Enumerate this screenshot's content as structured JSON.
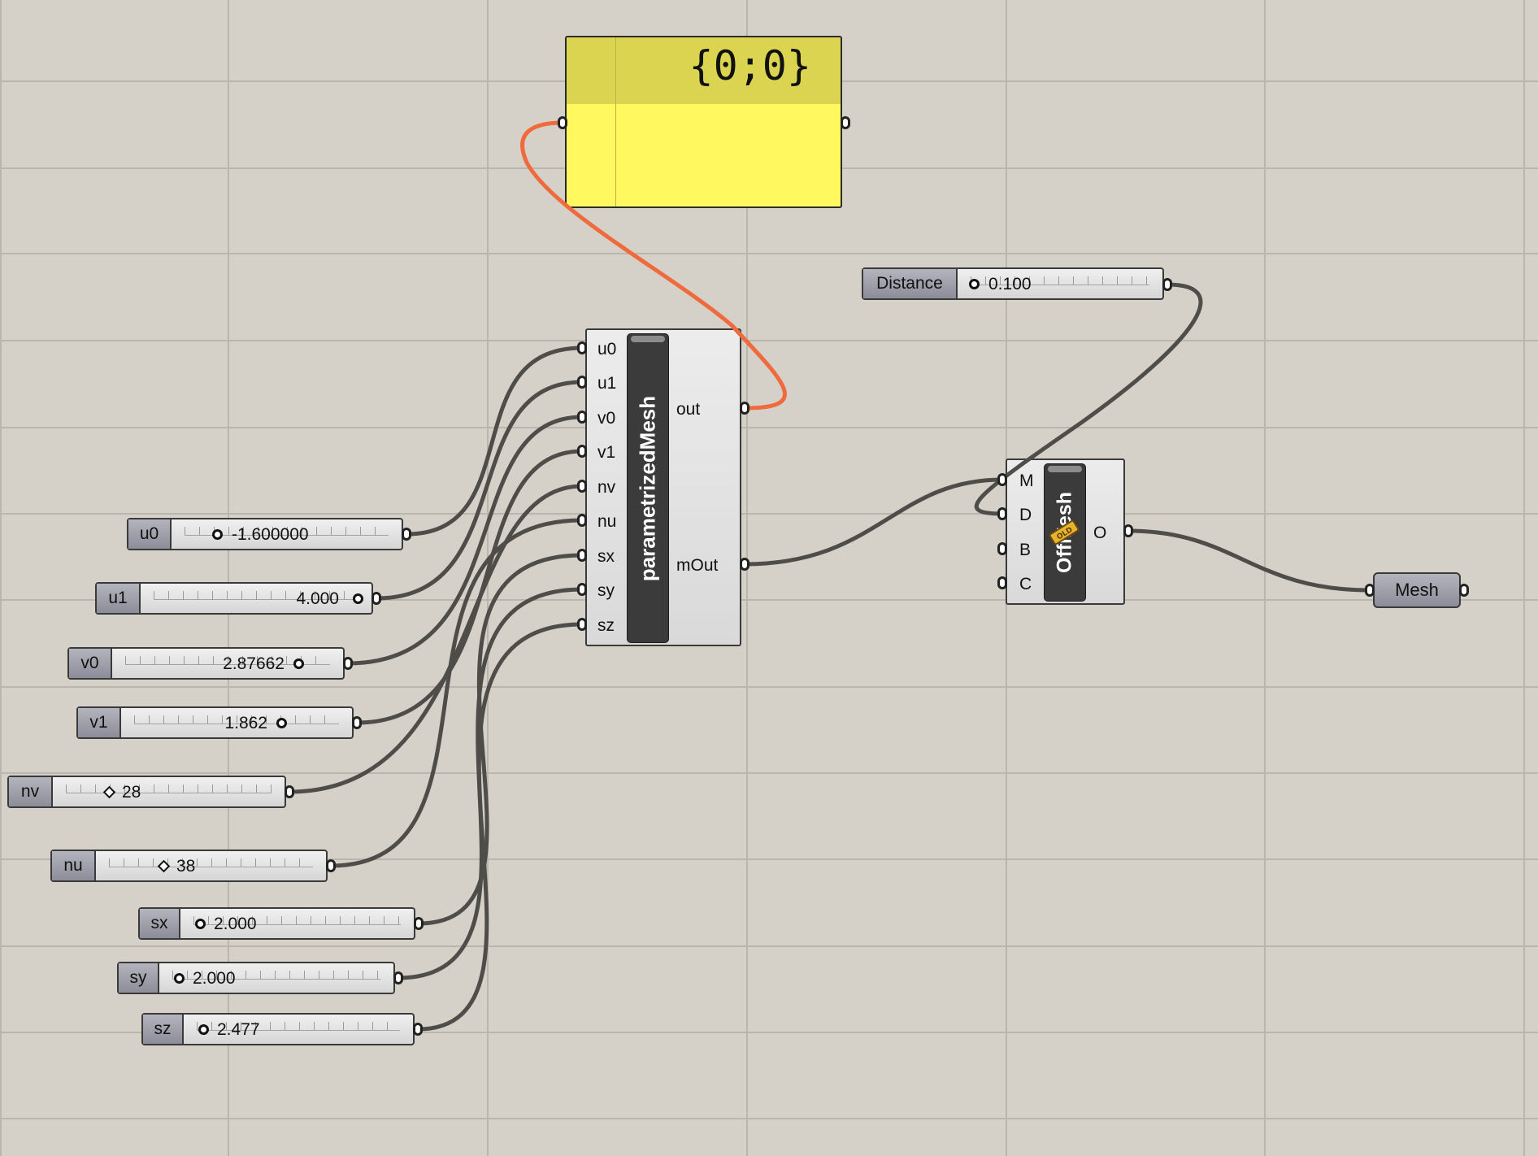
{
  "canvas": {
    "background": "#d5d1c9",
    "grid_color": "#b9b6ae",
    "wire_color": "#4f4d49",
    "selected_wire_color": "#ef6a3c"
  },
  "panel": {
    "text": "{0;0}"
  },
  "param_number_sliders": [
    {
      "label": "u0",
      "value": "-1.600000",
      "knob": "circle"
    },
    {
      "label": "u1",
      "value": "4.000",
      "knob": "circle"
    },
    {
      "label": "v0",
      "value": "2.87662",
      "knob": "circle"
    },
    {
      "label": "v1",
      "value": "1.862",
      "knob": "circle"
    },
    {
      "label": "nv",
      "value": "28",
      "knob": "diamond"
    },
    {
      "label": "nu",
      "value": "38",
      "knob": "diamond"
    },
    {
      "label": "sx",
      "value": "2.000",
      "knob": "circle"
    },
    {
      "label": "sy",
      "value": "2.000",
      "knob": "circle"
    },
    {
      "label": "sz",
      "value": "2.477",
      "knob": "circle"
    }
  ],
  "distance_slider": {
    "label": "Distance",
    "value": "0.100"
  },
  "parametrized_mesh": {
    "nickname": "parametrizedMesh",
    "inputs": [
      "u0",
      "u1",
      "v0",
      "v1",
      "nv",
      "nu",
      "sx",
      "sy",
      "sz"
    ],
    "outputs": [
      "out",
      "mOut"
    ]
  },
  "offset_mesh": {
    "nickname": "OffMesh",
    "badge": "OLD",
    "inputs": [
      "M",
      "D",
      "B",
      "C"
    ],
    "output": "O"
  },
  "mesh_param": {
    "label": "Mesh"
  }
}
